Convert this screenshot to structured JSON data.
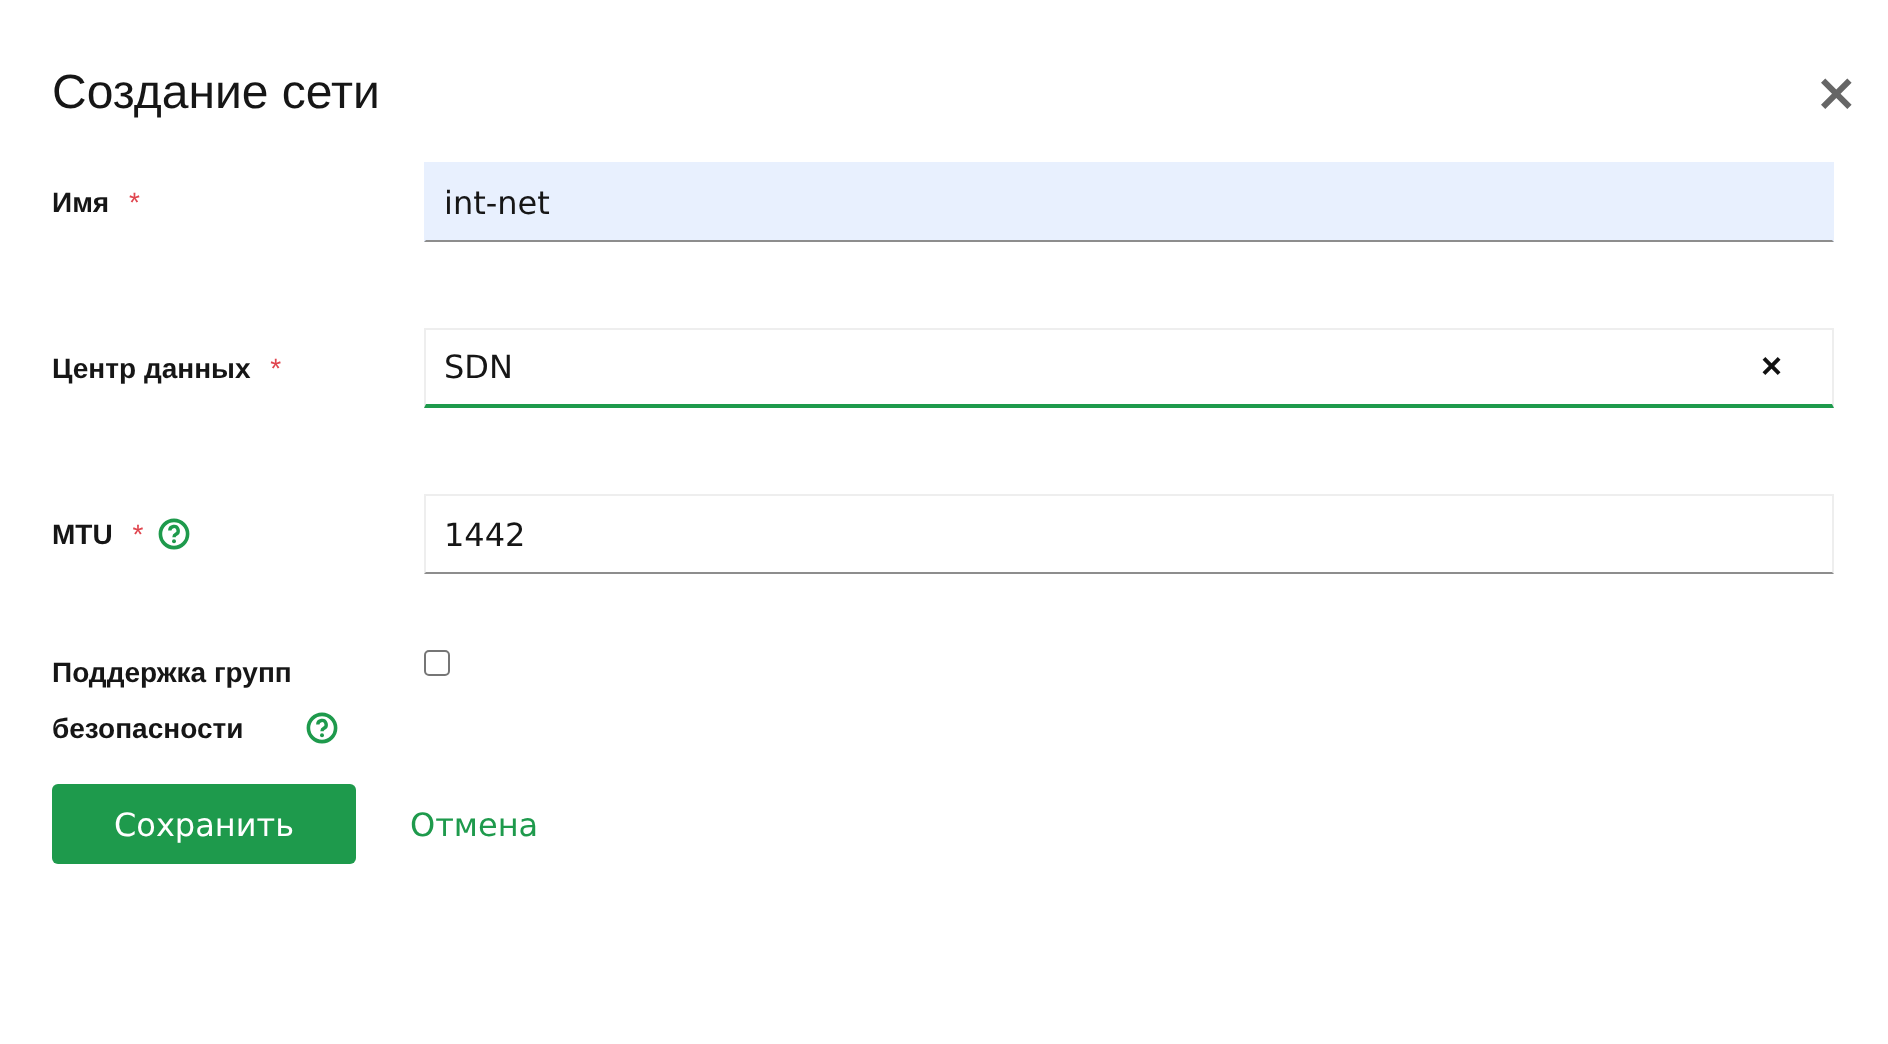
{
  "dialog": {
    "title": "Создание сети",
    "close": "×"
  },
  "fields": [
    {
      "kind": "text",
      "label": "Имя",
      "required_mark": "*",
      "help": false,
      "value": "int-net",
      "autofilled": true,
      "focused": false
    },
    {
      "kind": "select",
      "label": "Центр данных",
      "required_mark": "*",
      "help": false,
      "value": "SDN",
      "clear": "×",
      "autofilled": false,
      "focused": true
    },
    {
      "kind": "text",
      "label": "MTU",
      "required_mark": "*",
      "help": true,
      "value": "1442",
      "autofilled": false,
      "focused": false
    },
    {
      "kind": "checkbox",
      "label": "Поддержка групп безопасности",
      "help": true,
      "checked": false
    }
  ],
  "buttons": [
    {
      "kind": "primary",
      "label": "Сохранить"
    },
    {
      "kind": "link",
      "label": "Отмена"
    }
  ]
}
